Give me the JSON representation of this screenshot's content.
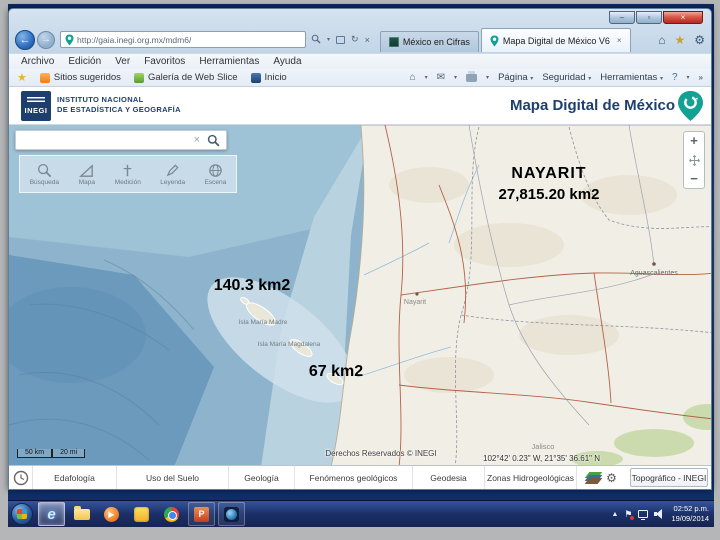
{
  "browser": {
    "url": "http://gaia.inegi.org.mx/mdm6/",
    "tabs": [
      {
        "label": "México en Cifras"
      },
      {
        "label": "Mapa Digital de México V6"
      }
    ],
    "menu": [
      "Archivo",
      "Edición",
      "Ver",
      "Favoritos",
      "Herramientas",
      "Ayuda"
    ],
    "favorites": [
      "Sitios sugeridos",
      "Galería de Web Slice",
      "Inicio"
    ],
    "commands": [
      "Página",
      "Seguridad",
      "Herramientas"
    ]
  },
  "site": {
    "logo_text": "INEGI",
    "agency_line1": "INSTITUTO NACIONAL",
    "agency_line2": "DE ESTADÍSTICA Y GEOGRAFÍA",
    "app_title": "Mapa Digital de México"
  },
  "map": {
    "toolbar": [
      {
        "label": "Búsqueda"
      },
      {
        "label": "Mapa"
      },
      {
        "label": "Medición"
      },
      {
        "label": "Leyenda"
      },
      {
        "label": "Escena"
      }
    ],
    "zoom_in": "+",
    "zoom_out": "−",
    "annotations": {
      "state_name": "NAYARIT",
      "state_area": "27,815.20 km2",
      "island_area_1": "140.3 km2",
      "island_area_2": "67 km2"
    },
    "labels": {
      "island_1": "Isla María Madre",
      "island_2": "Isla María Magdalena",
      "state": "Nayarit",
      "jalisco": "Jalisco",
      "aguascalientes": "Aguascalientes"
    },
    "scale_km": "50 km",
    "scale_mi": "20 mi",
    "attribution": "Derechos Reservados © INEGI",
    "coordinates": "102°42' 0.23\" W, 21°35' 36.61\" N"
  },
  "layer_bar": {
    "tabs": [
      "Edafología",
      "Uso del Suelo",
      "Geología",
      "Fenómenos geológicos",
      "Geodesia",
      "Zonas Hidrogeológicas"
    ],
    "basemap": "Topográfico - INEGI"
  },
  "taskbar": {
    "time": "02:52 p.m.",
    "date": "19/09/2014"
  },
  "colors": {
    "accent_teal": "#12a193",
    "navy": "#1d3f6e"
  }
}
